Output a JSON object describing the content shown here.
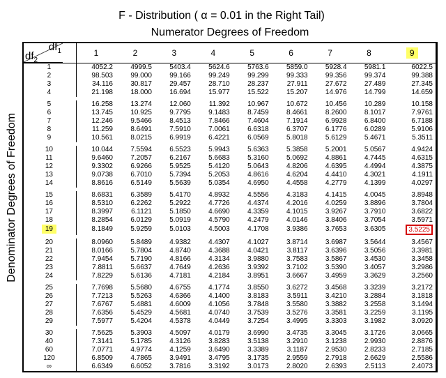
{
  "title_prefix": "F - Distribution ( ",
  "title_alpha": "α",
  "title_suffix": " = 0.01 in the Right Tail)",
  "numerator_label": "Numerator Degrees of Freedom",
  "denominator_label": "Denominator Degrees of Freedom",
  "df1_label": "df",
  "df1_sub": "1",
  "df2_label": "df",
  "df2_sub": "2",
  "columns": [
    "1",
    "2",
    "3",
    "4",
    "5",
    "6",
    "7",
    "8",
    "9"
  ],
  "highlight_col_index": 8,
  "groups": [
    [
      {
        "label": "1",
        "v": [
          "4052.2",
          "4999.5",
          "5403.4",
          "5624.6",
          "5763.6",
          "5859.0",
          "5928.4",
          "5981.1",
          "6022.5"
        ]
      },
      {
        "label": "2",
        "v": [
          "98.503",
          "99.000",
          "99.166",
          "99.249",
          "99.299",
          "99.333",
          "99.356",
          "99.374",
          "99.388"
        ]
      },
      {
        "label": "3",
        "v": [
          "34.116",
          "30.817",
          "29.457",
          "28.710",
          "28.237",
          "27.911",
          "27.672",
          "27.489",
          "27.345"
        ]
      },
      {
        "label": "4",
        "v": [
          "21.198",
          "18.000",
          "16.694",
          "15.977",
          "15.522",
          "15.207",
          "14.976",
          "14.799",
          "14.659"
        ]
      }
    ],
    [
      {
        "label": "5",
        "v": [
          "16.258",
          "13.274",
          "12.060",
          "11.392",
          "10.967",
          "10.672",
          "10.456",
          "10.289",
          "10.158"
        ]
      },
      {
        "label": "6",
        "v": [
          "13.745",
          "10.925",
          "9.7795",
          "9.1483",
          "8.7459",
          "8.4661",
          "8.2600",
          "8.1017",
          "7.9761"
        ]
      },
      {
        "label": "7",
        "v": [
          "12.246",
          "9.5466",
          "8.4513",
          "7.8466",
          "7.4604",
          "7.1914",
          "6.9928",
          "6.8400",
          "6.7188"
        ]
      },
      {
        "label": "8",
        "v": [
          "11.259",
          "8.6491",
          "7.5910",
          "7.0061",
          "6.6318",
          "6.3707",
          "6.1776",
          "6.0289",
          "5.9106"
        ]
      },
      {
        "label": "9",
        "v": [
          "10.561",
          "8.0215",
          "6.9919",
          "6.4221",
          "6.0569",
          "5.8018",
          "5.6129",
          "5.4671",
          "5.3511"
        ]
      }
    ],
    [
      {
        "label": "10",
        "v": [
          "10.044",
          "7.5594",
          "6.5523",
          "5.9943",
          "5.6363",
          "5.3858",
          "5.2001",
          "5.0567",
          "4.9424"
        ]
      },
      {
        "label": "11",
        "v": [
          "9.6460",
          "7.2057",
          "6.2167",
          "5.6683",
          "5.3160",
          "5.0692",
          "4.8861",
          "4.7445",
          "4.6315"
        ]
      },
      {
        "label": "12",
        "v": [
          "9.3302",
          "6.9266",
          "5.9525",
          "5.4120",
          "5.0643",
          "4.8206",
          "4.6395",
          "4.4994",
          "4.3875"
        ]
      },
      {
        "label": "13",
        "v": [
          "9.0738",
          "6.7010",
          "5.7394",
          "5.2053",
          "4.8616",
          "4.6204",
          "4.4410",
          "4.3021",
          "4.1911"
        ]
      },
      {
        "label": "14",
        "v": [
          "8.8616",
          "6.5149",
          "5.5639",
          "5.0354",
          "4.6950",
          "4.4558",
          "4.2779",
          "4.1399",
          "4.0297"
        ]
      }
    ],
    [
      {
        "label": "15",
        "v": [
          "8.6831",
          "6.3589",
          "5.4170",
          "4.8932",
          "4.5556",
          "4.3183",
          "4.1415",
          "4.0045",
          "3.8948"
        ]
      },
      {
        "label": "16",
        "v": [
          "8.5310",
          "6.2262",
          "5.2922",
          "4.7726",
          "4.4374",
          "4.2016",
          "4.0259",
          "3.8896",
          "3.7804"
        ]
      },
      {
        "label": "17",
        "v": [
          "8.3997",
          "6.1121",
          "5.1850",
          "4.6690",
          "4.3359",
          "4.1015",
          "3.9267",
          "3.7910",
          "3.6822"
        ]
      },
      {
        "label": "18",
        "v": [
          "8.2854",
          "6.0129",
          "5.0919",
          "4.5790",
          "4.2479",
          "4.0146",
          "3.8406",
          "3.7054",
          "3.5971"
        ]
      },
      {
        "label": "19",
        "v": [
          "8.1849",
          "5.9259",
          "5.0103",
          "4.5003",
          "4.1708",
          "3.9386",
          "3.7653",
          "3.6305",
          "3.5225"
        ],
        "highlight_row": true,
        "box_cell": 8
      }
    ],
    [
      {
        "label": "20",
        "v": [
          "8.0960",
          "5.8489",
          "4.9382",
          "4.4307",
          "4.1027",
          "3.8714",
          "3.6987",
          "3.5644",
          "3.4567"
        ]
      },
      {
        "label": "21",
        "v": [
          "8.0166",
          "5.7804",
          "4.8740",
          "4.3688",
          "4.0421",
          "3.8117",
          "3.6396",
          "3.5056",
          "3.3981"
        ]
      },
      {
        "label": "22",
        "v": [
          "7.9454",
          "5.7190",
          "4.8166",
          "4.3134",
          "3.9880",
          "3.7583",
          "3.5867",
          "3.4530",
          "3.3458"
        ]
      },
      {
        "label": "23",
        "v": [
          "7.8811",
          "5.6637",
          "4.7649",
          "4.2636",
          "3.9392",
          "3.7102",
          "3.5390",
          "3.4057",
          "3.2986"
        ]
      },
      {
        "label": "24",
        "v": [
          "7.8229",
          "5.6136",
          "4.7181",
          "4.2184",
          "3.8951",
          "3.6667",
          "3.4959",
          "3.3629",
          "3.2560"
        ]
      }
    ],
    [
      {
        "label": "25",
        "v": [
          "7.7698",
          "5.5680",
          "4.6755",
          "4.1774",
          "3.8550",
          "3.6272",
          "3.4568",
          "3.3239",
          "3.2172"
        ]
      },
      {
        "label": "26",
        "v": [
          "7.7213",
          "5.5263",
          "4.6366",
          "4.1400",
          "3.8183",
          "3.5911",
          "3.4210",
          "3.2884",
          "3.1818"
        ]
      },
      {
        "label": "27",
        "v": [
          "7.6767",
          "5.4881",
          "4.6009",
          "4.1056",
          "3.7848",
          "3.5580",
          "3.3882",
          "3.2558",
          "3.1494"
        ]
      },
      {
        "label": "28",
        "v": [
          "7.6356",
          "5.4529",
          "4.5681",
          "4.0740",
          "3.7539",
          "3.5276",
          "3.3581",
          "3.2259",
          "3.1195"
        ]
      },
      {
        "label": "29",
        "v": [
          "7.5977",
          "5.4204",
          "4.5378",
          "4.0449",
          "3.7254",
          "3.4995",
          "3.3303",
          "3.1982",
          "3.0920"
        ]
      }
    ],
    [
      {
        "label": "30",
        "v": [
          "7.5625",
          "5.3903",
          "4.5097",
          "4.0179",
          "3.6990",
          "3.4735",
          "3.3045",
          "3.1726",
          "3.0665"
        ]
      },
      {
        "label": "40",
        "v": [
          "7.3141",
          "5.1785",
          "4.3126",
          "3.8283",
          "3.5138",
          "3.2910",
          "3.1238",
          "2.9930",
          "2.8876"
        ]
      },
      {
        "label": "60",
        "v": [
          "7.0771",
          "4.9774",
          "4.1259",
          "3.6490",
          "3.3389",
          "3.1187",
          "2.9530",
          "2.8233",
          "2.7185"
        ]
      },
      {
        "label": "120",
        "v": [
          "6.8509",
          "4.7865",
          "3.9491",
          "3.4795",
          "3.1735",
          "2.9559",
          "2.7918",
          "2.6629",
          "2.5586"
        ]
      },
      {
        "label": "∞",
        "v": [
          "6.6349",
          "6.6052",
          "3.7816",
          "3.3192",
          "3.0173",
          "2.8020",
          "2.6393",
          "2.5113",
          "2.4073"
        ]
      }
    ]
  ]
}
